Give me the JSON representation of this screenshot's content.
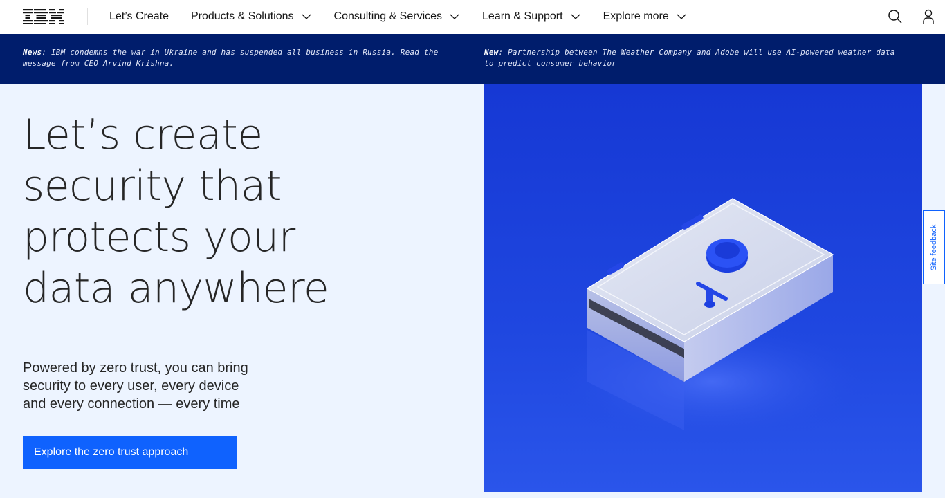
{
  "brand": {
    "logo_text": "IBM"
  },
  "nav": {
    "items": [
      {
        "label": "Let’s Create",
        "has_menu": false
      },
      {
        "label": "Products & Solutions",
        "has_menu": true
      },
      {
        "label": "Consulting & Services",
        "has_menu": true
      },
      {
        "label": "Learn & Support",
        "has_menu": true
      },
      {
        "label": "Explore more",
        "has_menu": true
      }
    ],
    "icons": [
      "search-icon",
      "user-icon"
    ]
  },
  "news": [
    {
      "prefix": "News",
      "text": ": IBM condemns the war in Ukraine and has suspended all business in Russia. Read the message from CEO Arvind Krishna."
    },
    {
      "prefix": "New",
      "text": ": Partnership between The Weather Company and Adobe will use AI-powered weather data to predict consumer behavior"
    }
  ],
  "hero": {
    "title_lines": [
      "Let’s create",
      "security that",
      "protects your",
      "data anywhere"
    ],
    "subtitle_lines": [
      "Powered by zero trust, you can bring",
      "security to every user, every device",
      "and every connection — every time"
    ],
    "cta_label": "Explore the zero trust approach"
  },
  "feedback": {
    "label": "Site feedback"
  },
  "colors": {
    "newsbar_bg": "#001d6c",
    "hero_bg": "#edf4ff",
    "cta_bg": "#0f62fe",
    "image_bg": "#1a3ed8"
  }
}
